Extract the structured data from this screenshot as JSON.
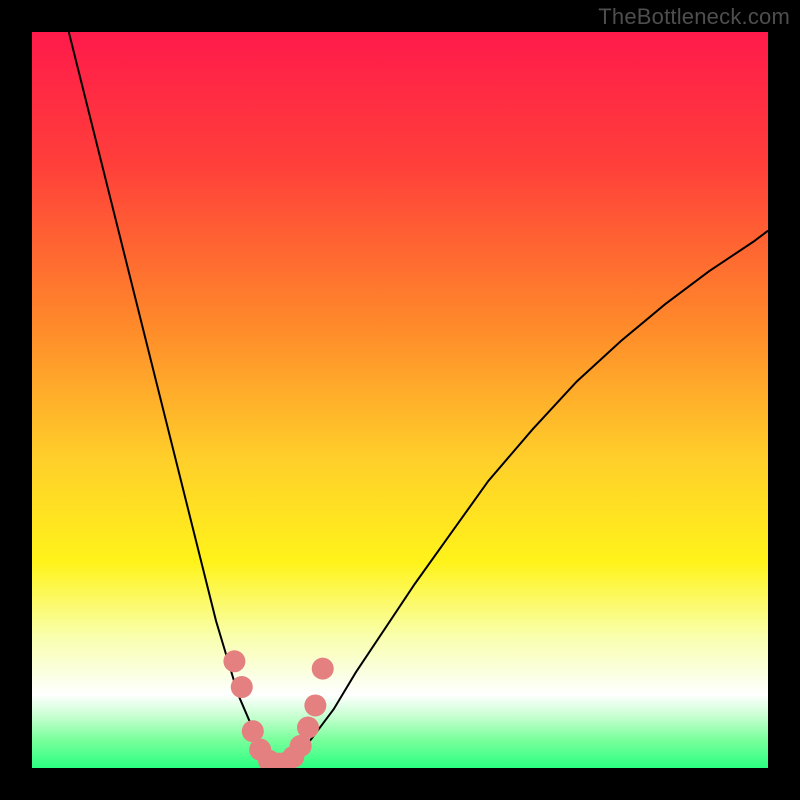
{
  "watermark": "TheBottleneck.com",
  "colors": {
    "frame": "#000000",
    "curve": "#000000",
    "marker_fill": "#e58080",
    "gradient_stops": [
      {
        "offset": 0.0,
        "color": "#ff1a4b"
      },
      {
        "offset": 0.18,
        "color": "#ff3f3a"
      },
      {
        "offset": 0.4,
        "color": "#ff8a2a"
      },
      {
        "offset": 0.58,
        "color": "#ffcf2a"
      },
      {
        "offset": 0.72,
        "color": "#fff31a"
      },
      {
        "offset": 0.82,
        "color": "#f9ffab"
      },
      {
        "offset": 0.875,
        "color": "#faffe5"
      },
      {
        "offset": 0.9,
        "color": "#ffffff"
      },
      {
        "offset": 0.93,
        "color": "#c6ffd0"
      },
      {
        "offset": 0.96,
        "color": "#7dff9e"
      },
      {
        "offset": 1.0,
        "color": "#2bff80"
      }
    ]
  },
  "chart_data": {
    "type": "line",
    "title": "",
    "xlabel": "",
    "ylabel": "",
    "xlim": [
      0,
      100
    ],
    "ylim": [
      0,
      100
    ],
    "series": [
      {
        "name": "bottleneck-curve-left",
        "x": [
          5,
          7,
          9,
          11,
          13,
          15,
          17,
          19,
          21,
          23,
          25,
          26.5,
          28,
          29.5,
          31,
          32.5,
          34
        ],
        "y": [
          100,
          92,
          84,
          76,
          68,
          60,
          52,
          44,
          36,
          28,
          20,
          15,
          10,
          6.5,
          3.5,
          1.5,
          0.5
        ]
      },
      {
        "name": "bottleneck-curve-right",
        "x": [
          34,
          36,
          38,
          41,
          44,
          48,
          52,
          57,
          62,
          68,
          74,
          80,
          86,
          92,
          98,
          100
        ],
        "y": [
          0.5,
          1.5,
          4,
          8,
          13,
          19,
          25,
          32,
          39,
          46,
          52.5,
          58,
          63,
          67.5,
          71.5,
          73
        ]
      }
    ],
    "markers": {
      "name": "sample-points",
      "x": [
        27.5,
        28.5,
        30.0,
        31.0,
        32.2,
        33.5,
        34.5,
        35.5,
        36.5,
        37.5,
        38.5,
        39.5
      ],
      "y": [
        14.5,
        11.0,
        5.0,
        2.5,
        1.0,
        0.6,
        0.7,
        1.5,
        3.0,
        5.5,
        8.5,
        13.5
      ]
    }
  }
}
